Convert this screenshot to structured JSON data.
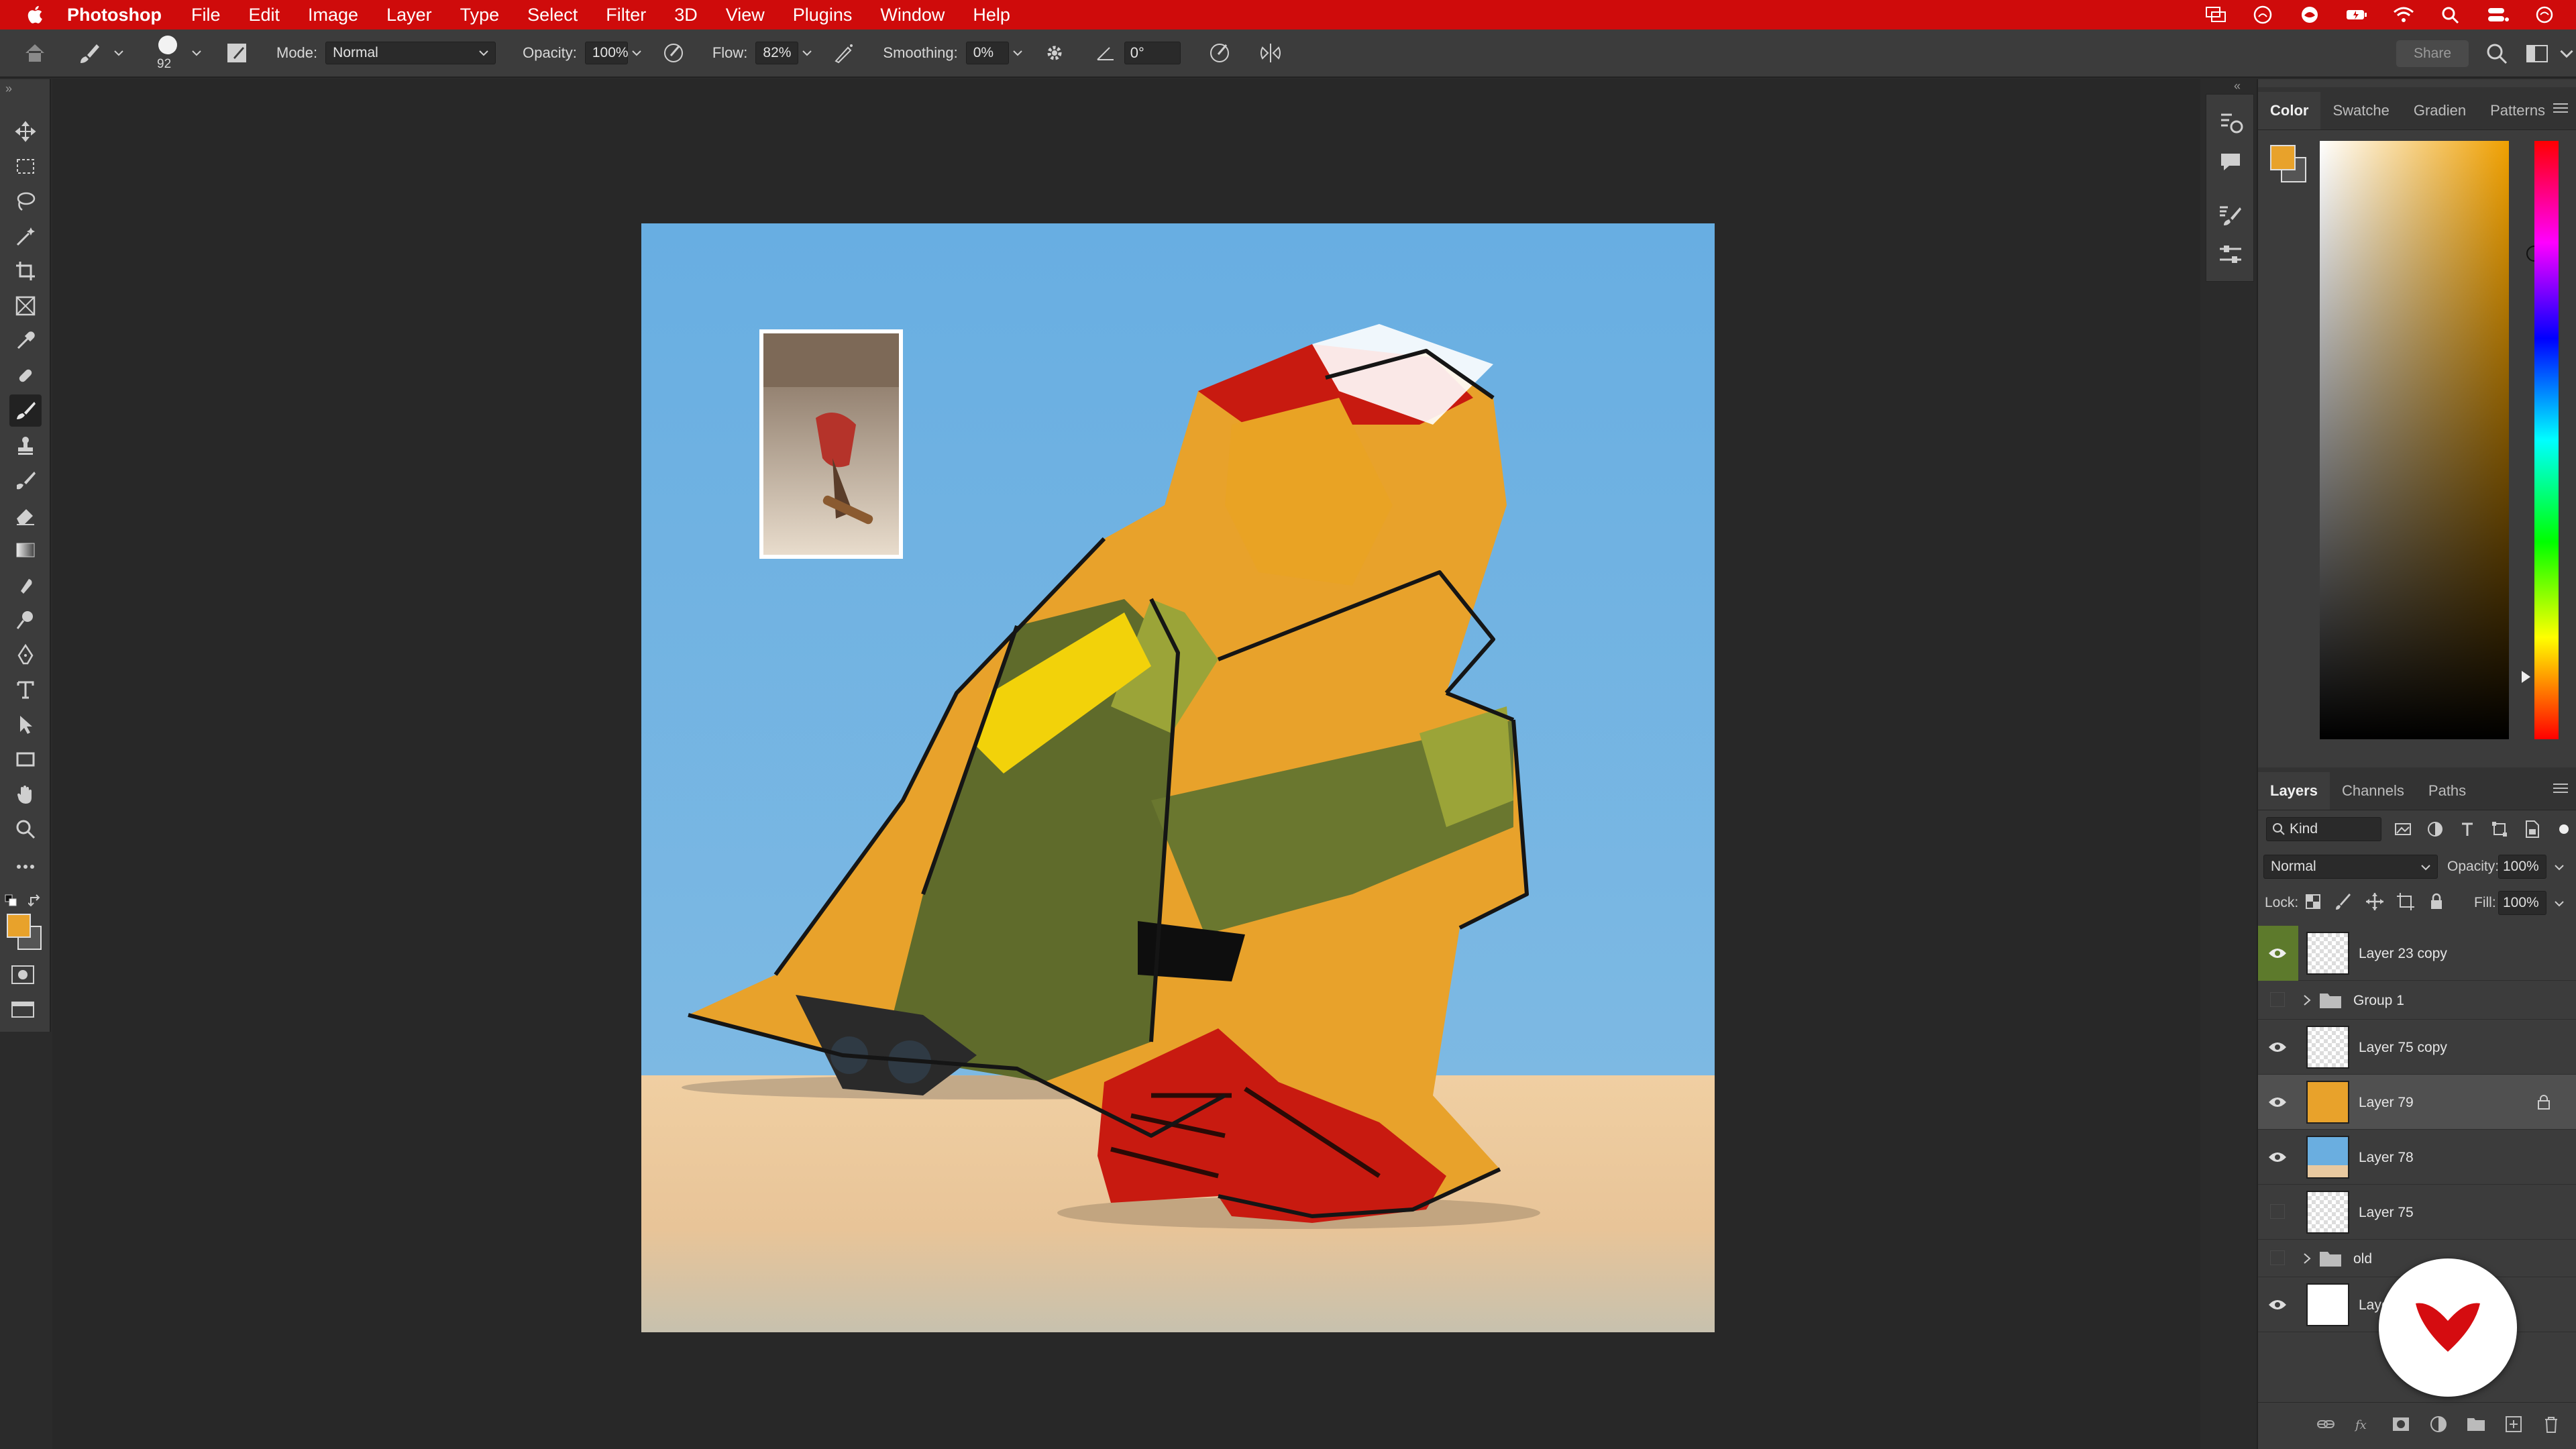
{
  "menubar": {
    "app_name": "Photoshop",
    "items": [
      "File",
      "Edit",
      "Image",
      "Layer",
      "Type",
      "Select",
      "Filter",
      "3D",
      "View",
      "Plugins",
      "Window",
      "Help"
    ]
  },
  "options": {
    "brush_size": "92",
    "mode_label": "Mode:",
    "mode_value": "Normal",
    "opacity_label": "Opacity:",
    "opacity_value": "100%",
    "flow_label": "Flow:",
    "flow_value": "82%",
    "smoothing_label": "Smoothing:",
    "smoothing_value": "0%",
    "angle_value": "0°",
    "share_label": "Share"
  },
  "color_panel": {
    "tabs": [
      "Color",
      "Swatche",
      "Gradien",
      "Patterns"
    ],
    "foreground": "#e8a22b",
    "background": "#555555"
  },
  "layers_panel": {
    "tabs": [
      "Layers",
      "Channels",
      "Paths"
    ],
    "filter_kind": "Kind",
    "blend_mode": "Normal",
    "opacity_label": "Opacity:",
    "opacity_value": "100%",
    "lock_label": "Lock:",
    "fill_label": "Fill:",
    "fill_value": "100%",
    "layers": [
      {
        "name": "Layer 23 copy",
        "visible": true,
        "type": "layer"
      },
      {
        "name": "Group 1",
        "visible": false,
        "type": "group"
      },
      {
        "name": "Layer 75 copy",
        "visible": true,
        "type": "layer"
      },
      {
        "name": "Layer 79",
        "visible": true,
        "type": "layer",
        "selected": true,
        "locked": true
      },
      {
        "name": "Layer 78",
        "visible": true,
        "type": "layer"
      },
      {
        "name": "Layer 75",
        "visible": false,
        "type": "layer"
      },
      {
        "name": "old",
        "visible": false,
        "type": "group"
      },
      {
        "name": "Laye",
        "visible": true,
        "type": "layer"
      }
    ]
  },
  "colors": {
    "menubar_red": "#cf0b0b",
    "sky": "#6aaee0",
    "sand": "#e9c9a0",
    "shoe_red": "#c81a10",
    "skin_orange": "#e8a22b",
    "pants_green": "#5a6b2a"
  }
}
